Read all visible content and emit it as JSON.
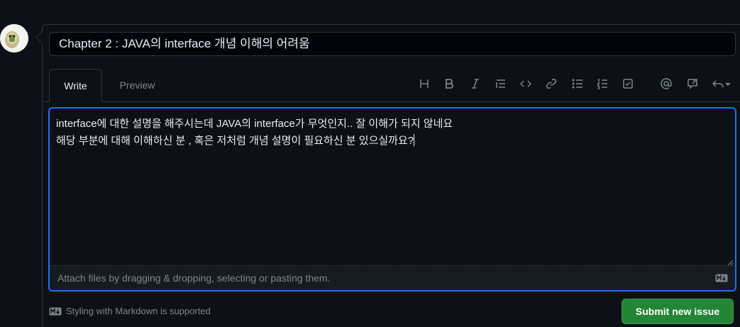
{
  "issue": {
    "title_value": "Chapter 2 : JAVA의 interface 개념 이해의 어려움"
  },
  "tabs": [
    {
      "label": "Write"
    },
    {
      "label": "Preview"
    }
  ],
  "toolbar": {
    "icons": [
      "heading-icon",
      "bold-icon",
      "italic-icon",
      "quote-icon",
      "code-icon",
      "link-icon",
      "unordered-list-icon",
      "ordered-list-icon",
      "task-list-icon",
      "mention-icon",
      "reference-icon",
      "undo-icon"
    ]
  },
  "editor": {
    "line1": "interface에 대한 설명을 해주시는데 JAVA의 interface가 무엇인지.. 잘 이해가 되지 않네요",
    "line2": "해당 부분에 대해 이해하신 분 , 혹은 저처럼 개념 설명이 필요하신 분 있으실까요?",
    "attach_hint": "Attach files by dragging & dropping, selecting or pasting them."
  },
  "footer": {
    "markdown_note": "Styling with Markdown is supported",
    "submit_label": "Submit new issue"
  },
  "colors": {
    "background": "#0d1117",
    "border": "#30363d",
    "focus": "#1f6feb",
    "submit": "#238636",
    "muted": "#7d8590"
  }
}
